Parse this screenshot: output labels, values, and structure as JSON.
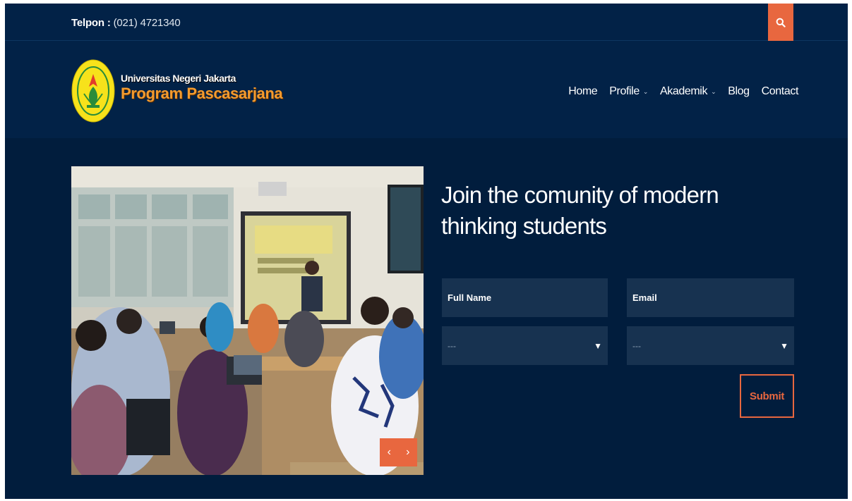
{
  "topbar": {
    "phone_label": "Telpon :",
    "phone_number": "(021) 4721340",
    "search_icon": "search-icon"
  },
  "brand": {
    "university": "Universitas Negeri Jakarta",
    "program": "Program Pascasarjana",
    "logo_color": "#f7e21b"
  },
  "nav": {
    "items": [
      {
        "label": "Home",
        "dropdown": false
      },
      {
        "label": "Profile",
        "dropdown": true
      },
      {
        "label": "Akademik",
        "dropdown": true
      },
      {
        "label": "Blog",
        "dropdown": false
      },
      {
        "label": "Contact",
        "dropdown": false
      }
    ]
  },
  "hero": {
    "headline": "Join the comunity of modern thinking students",
    "carousel_prev": "‹",
    "carousel_next": "›"
  },
  "form": {
    "full_name_placeholder": "Full Name",
    "email_placeholder": "Email",
    "select1_value": "---",
    "select2_value": "---",
    "submit_label": "Submit"
  },
  "colors": {
    "background": "#011d3d",
    "header": "#022247",
    "accent": "#e8673f",
    "field": "#173250"
  }
}
